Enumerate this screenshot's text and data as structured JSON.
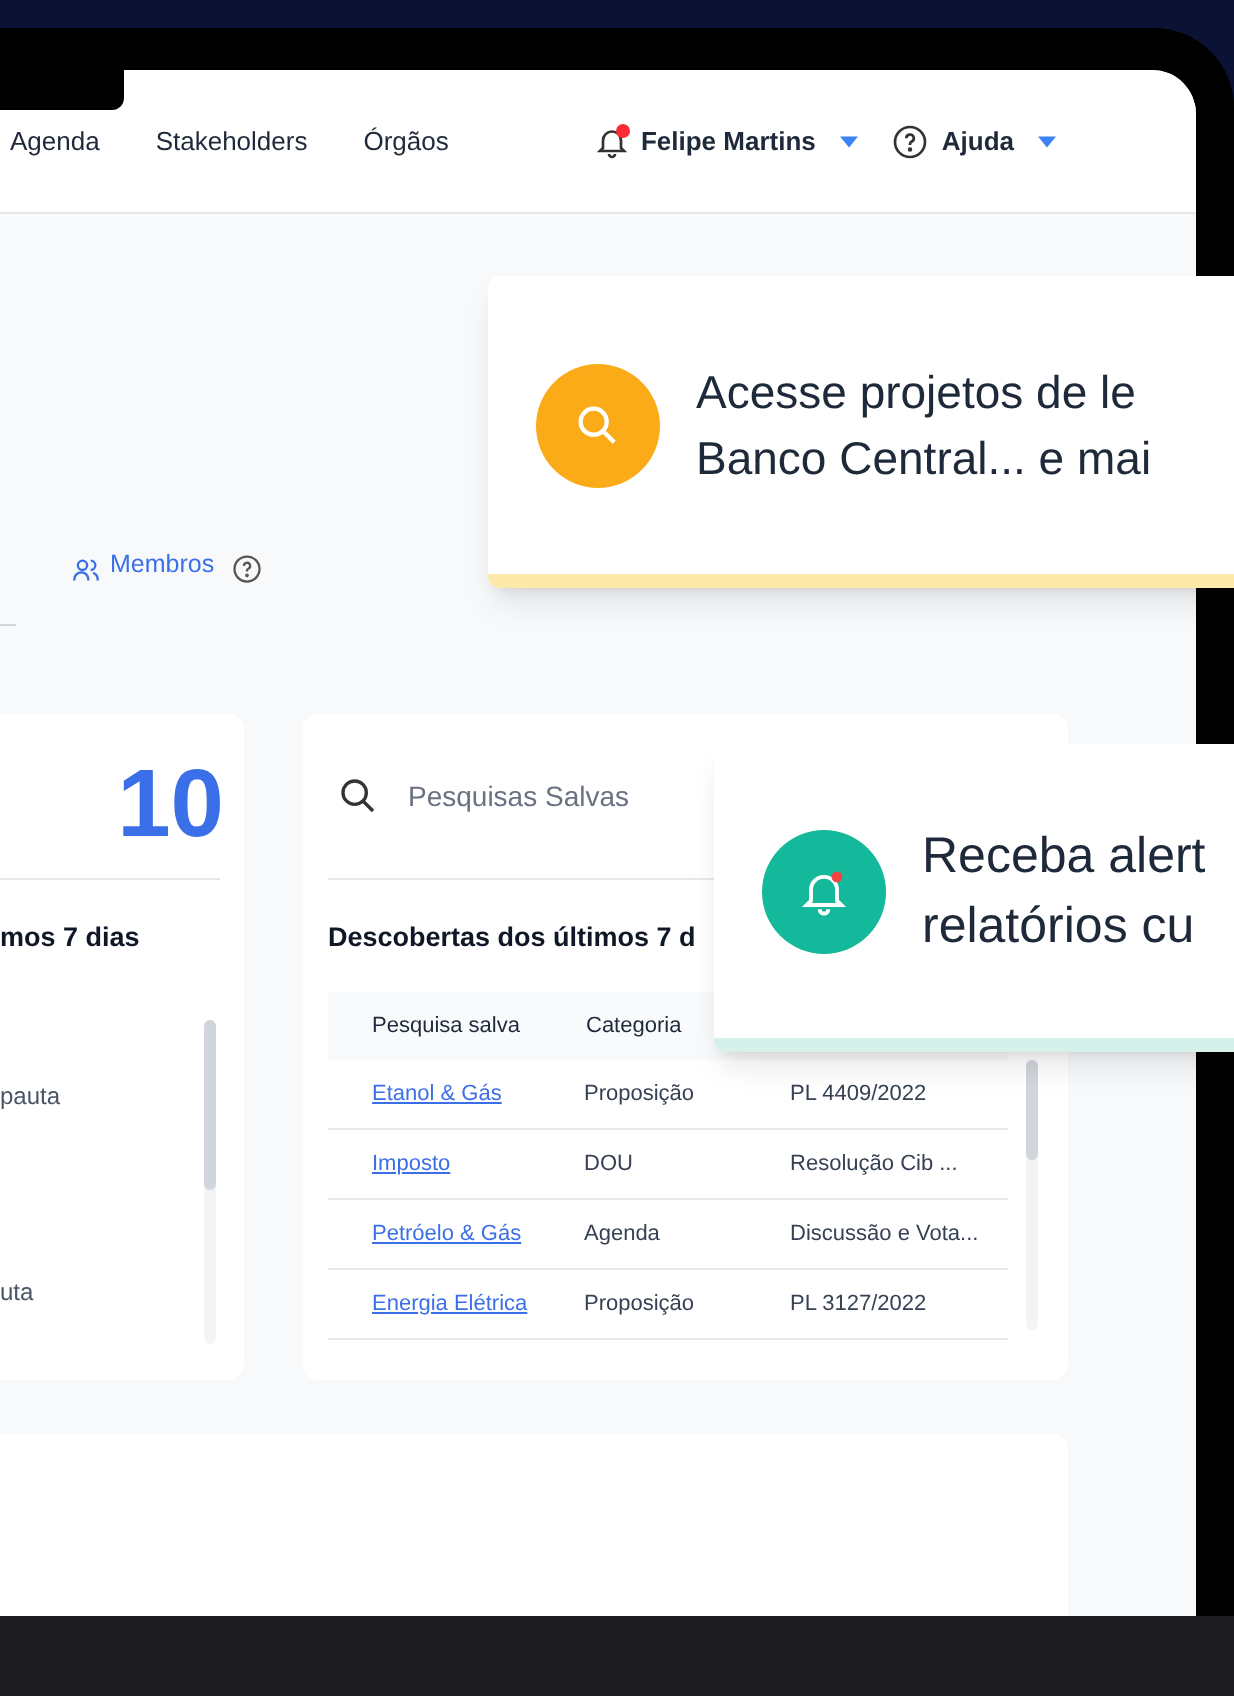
{
  "nav": {
    "links": [
      "Agenda",
      "Stakeholders",
      "Órgãos"
    ],
    "has_notification": true,
    "user": "Felipe Martins",
    "help": "Ajuda"
  },
  "members_link": "Membros",
  "left_card": {
    "count": "10",
    "heading": "mos 7 dias",
    "items": [
      "pauta",
      "uta"
    ]
  },
  "saved_searches": {
    "placeholder": "Pesquisas Salvas",
    "heading": "Descobertas dos últimos 7 d",
    "columns": [
      "Pesquisa salva",
      "Categoria"
    ],
    "rows": [
      [
        "Etanol & Gás",
        "Proposição",
        "PL 4409/2022"
      ],
      [
        "Imposto",
        "DOU",
        "Resolução Cib ..."
      ],
      [
        "Petróelo & Gás",
        "Agenda",
        "Discussão e Vota..."
      ],
      [
        "Energia Elétrica",
        "Proposição",
        "PL 3127/2022"
      ]
    ]
  },
  "callouts": [
    {
      "kind": "search",
      "lines": [
        "Acesse projetos de le",
        "Banco Central... e mai"
      ]
    },
    {
      "kind": "alert",
      "lines": [
        "Receba alert",
        "relatórios cu"
      ]
    }
  ]
}
